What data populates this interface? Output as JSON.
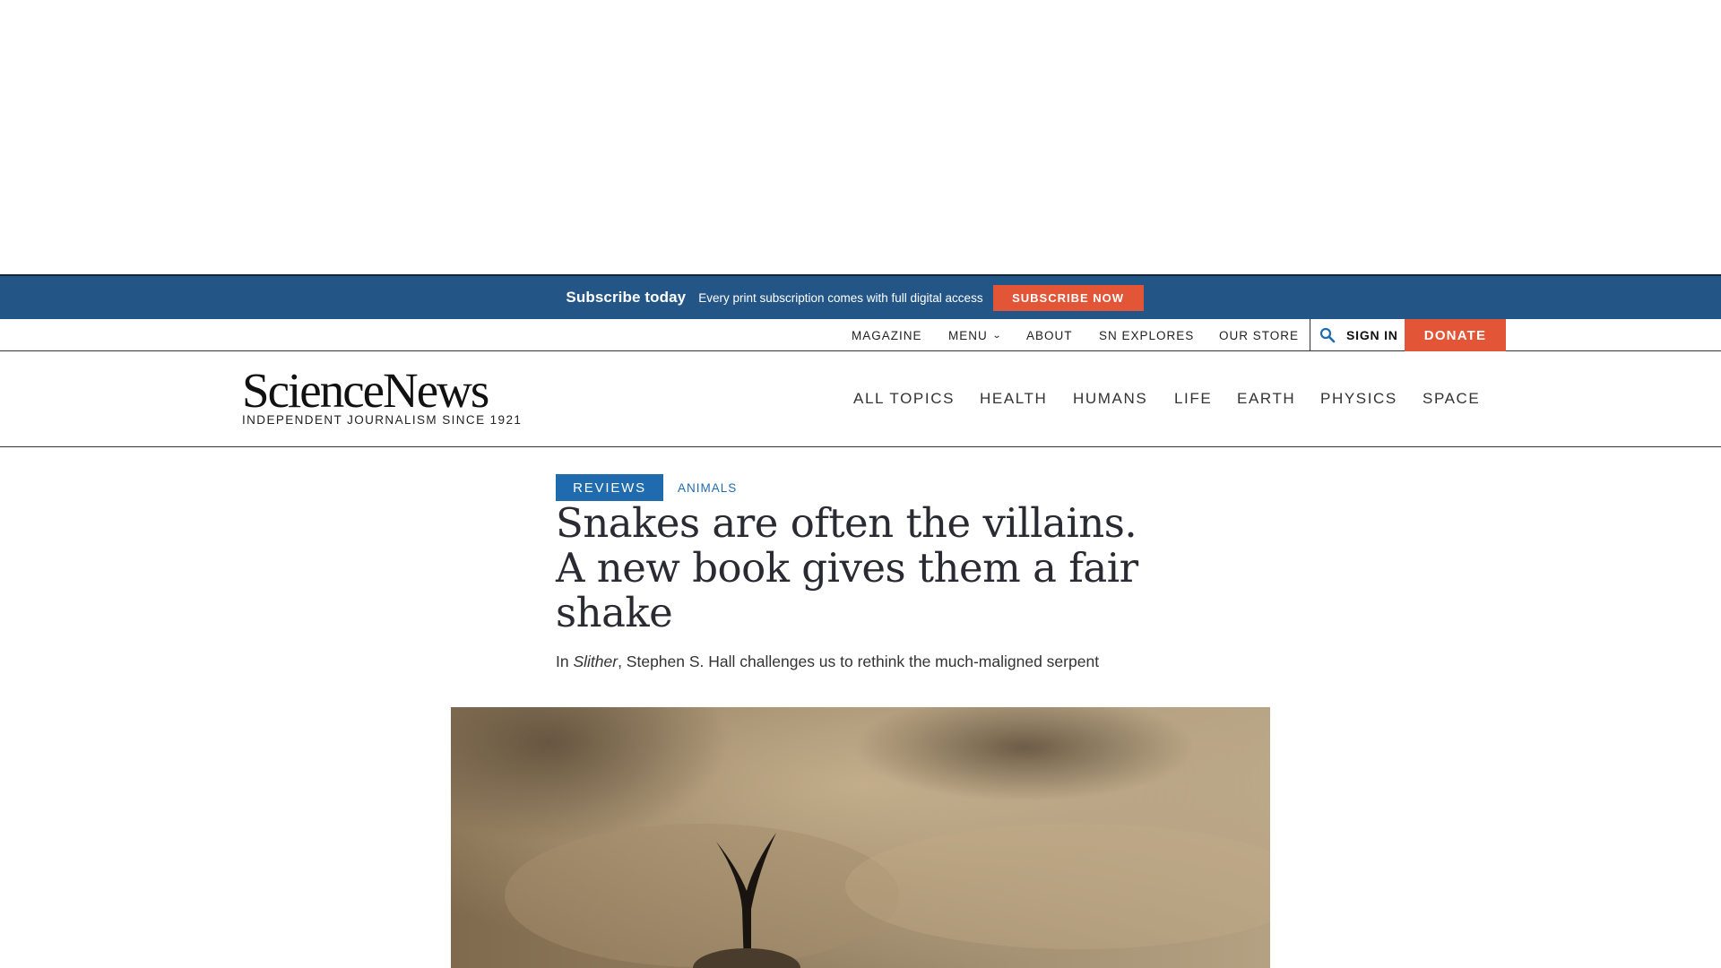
{
  "subscribe_bar": {
    "title": "Subscribe today",
    "description": "Every print subscription comes with full digital access",
    "button_label": "SUBSCRIBE NOW"
  },
  "utility_nav": {
    "items": [
      "MAGAZINE",
      "MENU",
      "ABOUT",
      "SN EXPLORES",
      "OUR STORE"
    ],
    "sign_in": "SIGN IN",
    "donate": "DONATE"
  },
  "masthead": {
    "logo": "ScienceNews",
    "tagline": "INDEPENDENT JOURNALISM SINCE 1921"
  },
  "main_nav": {
    "items": [
      "ALL TOPICS",
      "HEALTH",
      "HUMANS",
      "LIFE",
      "EARTH",
      "PHYSICS",
      "SPACE"
    ]
  },
  "article": {
    "category": "REVIEWS",
    "topic": "ANIMALS",
    "headline": "Snakes are often the villains. A new book gives them a fair shake",
    "dek": {
      "prefix": "In ",
      "book_title": "Slither",
      "suffix": ", Stephen S. Hall challenges us to rethink the much-maligned serpent"
    }
  },
  "colors": {
    "subscribe_bar_bg": "#235686",
    "accent_red": "#e25537",
    "reviews_blue": "#1f6bae"
  },
  "icons": {
    "search": "search-icon",
    "menu_chevron": "chevron-down-icon"
  }
}
